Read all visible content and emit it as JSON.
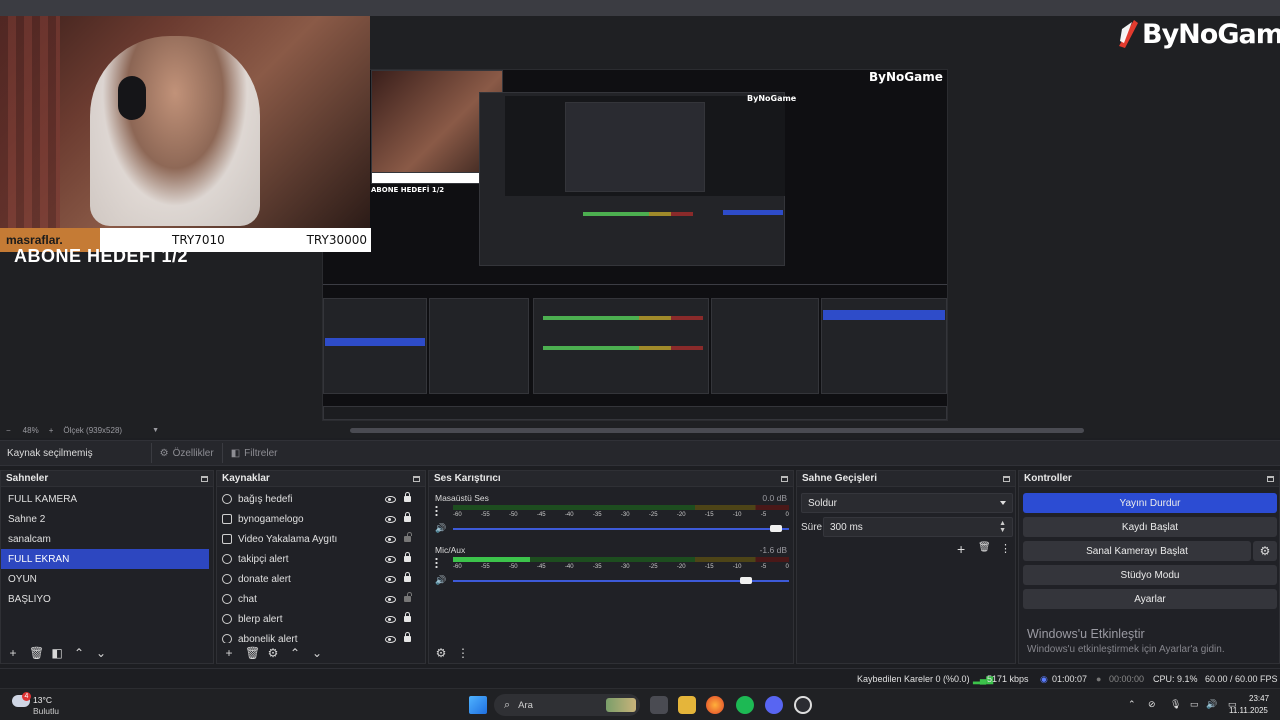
{
  "overlay": {
    "streamer_name": "masraflar.",
    "goal_current": "TRY7010",
    "goal_target": "TRY30000",
    "goal_title": "ABONE HEDEFİ 1/2",
    "brand": "ByNoGame",
    "nested_brand": "ByNoGame"
  },
  "zoom_bar": {
    "zoom": "48%",
    "scale": "Ölçek (939x528)",
    "minus": "−",
    "plus": "+"
  },
  "source_toolbar": {
    "no_source": "Kaynak seçilmemiş",
    "properties": "Özellikler",
    "filters": "Filtreler"
  },
  "scenes": {
    "title": "Sahneler",
    "items": [
      "FULL KAMERA",
      "Sahne 2",
      "sanalcam",
      "FULL EKRAN",
      "OYUN",
      "BAŞLIYO"
    ],
    "selected": "FULL EKRAN"
  },
  "sources": {
    "title": "Kaynaklar",
    "items": [
      {
        "name": "bağış hedefi",
        "locked": true
      },
      {
        "name": "bynogamelogo",
        "locked": true
      },
      {
        "name": "Video Yakalama Aygıtı",
        "locked": false
      },
      {
        "name": "takipçi alert",
        "locked": true
      },
      {
        "name": "donate alert",
        "locked": true
      },
      {
        "name": "chat",
        "locked": false
      },
      {
        "name": "blerp alert",
        "locked": true
      },
      {
        "name": "abonelik alert",
        "locked": true
      }
    ]
  },
  "mixer": {
    "title": "Ses Karıştırıcı",
    "channels": [
      {
        "name": "Masaüstü Ses",
        "db": "0.0 dB",
        "level": 0.0,
        "fader": 0.98
      },
      {
        "name": "Mic/Aux",
        "db": "-1.6 dB",
        "level": 0.23,
        "fader": 0.89
      }
    ],
    "ticks": [
      "-60",
      "-55",
      "-50",
      "-45",
      "-40",
      "-35",
      "-30",
      "-25",
      "-20",
      "-15",
      "-10",
      "-5",
      "0"
    ]
  },
  "transitions": {
    "title": "Sahne Geçişleri",
    "selected": "Soldur",
    "duration_label": "Süre",
    "duration_value": "300 ms"
  },
  "controls": {
    "title": "Kontroller",
    "stop_stream": "Yayını Durdur",
    "start_recording": "Kaydı Başlat",
    "virtual_camera": "Sanal Kamerayı Başlat",
    "studio_mode": "Stüdyo Modu",
    "settings": "Ayarlar",
    "activation_title": "Windows'u Etkinleştir",
    "activation_desc": "Windows'u etkinleştirmek için Ayarlar'a gidin."
  },
  "status": {
    "dropped_frames": "Kaybedilen Kareler 0 (%0.0)",
    "bitrate": "5171 kbps",
    "stream_time": "01:00:07",
    "record_time": "00:00:00",
    "cpu": "CPU: 9.1%",
    "fps": "60.00 / 60.00 FPS"
  },
  "taskbar": {
    "weather_temp": "13°C",
    "weather_desc": "Bulutlu",
    "weather_badge": "4",
    "search_placeholder": "Ara",
    "time": "23:47",
    "date": "11.11.2025"
  },
  "colors": {
    "accent": "#2d47c0",
    "stream_button": "#2c4cd3",
    "bitrate_green": "#3cc34b"
  }
}
